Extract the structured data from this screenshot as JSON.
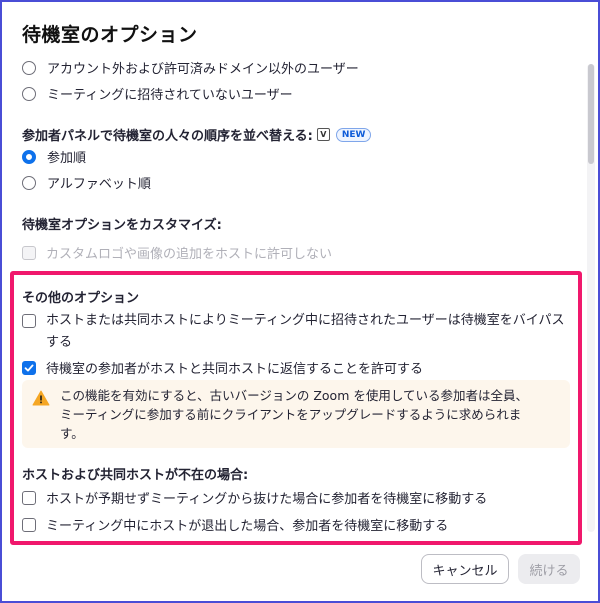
{
  "dialog": {
    "title": "待機室のオプション"
  },
  "who_goes_to_waiting_room": {
    "options": [
      {
        "label": "アカウント外および許可済みドメイン以外のユーザー",
        "checked": false
      },
      {
        "label": "ミーティングに招待されていないユーザー",
        "checked": false
      }
    ]
  },
  "sort_order": {
    "heading": "参加者パネルで待機室の人々の順序を並べ替える:",
    "info_icon": "V",
    "badge": "NEW",
    "options": [
      {
        "label": "参加順",
        "checked": true
      },
      {
        "label": "アルファベット順",
        "checked": false
      }
    ]
  },
  "customize": {
    "heading": "待機室オプションをカスタマイズ:",
    "option_label": "カスタムロゴや画像の追加をホストに許可しない",
    "disabled": true
  },
  "other_options": {
    "heading": "その他のオプション",
    "bypass_label_line1": "ホストまたは共同ホストによりミーティング中に招待されたユーザーは待機室をバイパス",
    "bypass_label_line2": "する",
    "bypass_checked": false,
    "reply_label": "待機室の参加者がホストと共同ホストに返信することを許可する",
    "reply_checked": true,
    "warning_line1": "この機能を有効にすると、古いバージョンの Zoom を使用している参加者は全員、",
    "warning_line2": "ミーティングに参加する前にクライアントをアップグレードするように求められま",
    "warning_line3": "す。",
    "warning_icon": "warning-triangle-icon"
  },
  "host_absent": {
    "heading": "ホストおよび共同ホストが不在の場合:",
    "options": [
      {
        "label": "ホストが予期せずミーティングから抜けた場合に参加者を待機室に移動する",
        "checked": false
      },
      {
        "label": "ミーティング中にホストが退出した場合、参加者を待機室に移動する",
        "checked": false
      }
    ]
  },
  "footer": {
    "cancel_label": "キャンセル",
    "continue_label": "続ける"
  },
  "colors": {
    "accent": "#0e71eb",
    "highlight": "#f0186c",
    "border": "#4a4dd6",
    "warning": "#f5a623"
  }
}
